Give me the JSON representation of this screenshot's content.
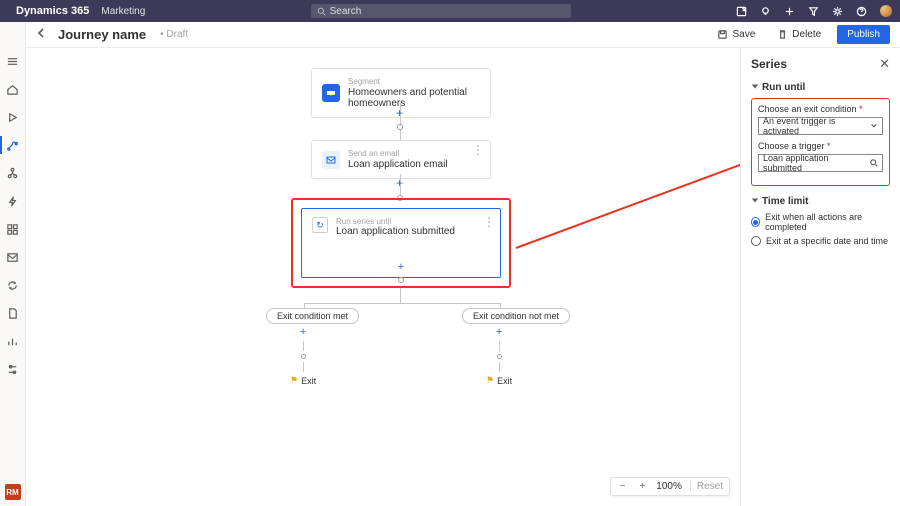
{
  "topnav": {
    "brand": "Dynamics 365",
    "module": "Marketing",
    "search_placeholder": "Search"
  },
  "cmdbar": {
    "title": "Journey name",
    "status": "• Draft",
    "save": "Save",
    "delete": "Delete",
    "publish": "Publish"
  },
  "leftrail_badge": "RM",
  "nodes": {
    "segment": {
      "kicker": "Segment",
      "title": "Homeowners and potential homeowners"
    },
    "email": {
      "kicker": "Send an email",
      "title": "Loan application email"
    },
    "series": {
      "kicker": "Run series until",
      "title": "Loan application submitted"
    }
  },
  "branches": {
    "left_chip": "Exit condition met",
    "right_chip": "Exit condition not met",
    "exit": "Exit"
  },
  "zoom": {
    "minus": "−",
    "plus": "+",
    "pct": "100%",
    "reset": "Reset"
  },
  "panel": {
    "title": "Series",
    "sec1": "Run until",
    "field1_label": "Choose an exit condition",
    "field1_value": "An event trigger is activated",
    "field2_label": "Choose a trigger",
    "field2_value": "Loan application submitted",
    "sec2": "Time limit",
    "radio1": "Exit when all actions are completed",
    "radio2": "Exit at a specific date and time"
  }
}
